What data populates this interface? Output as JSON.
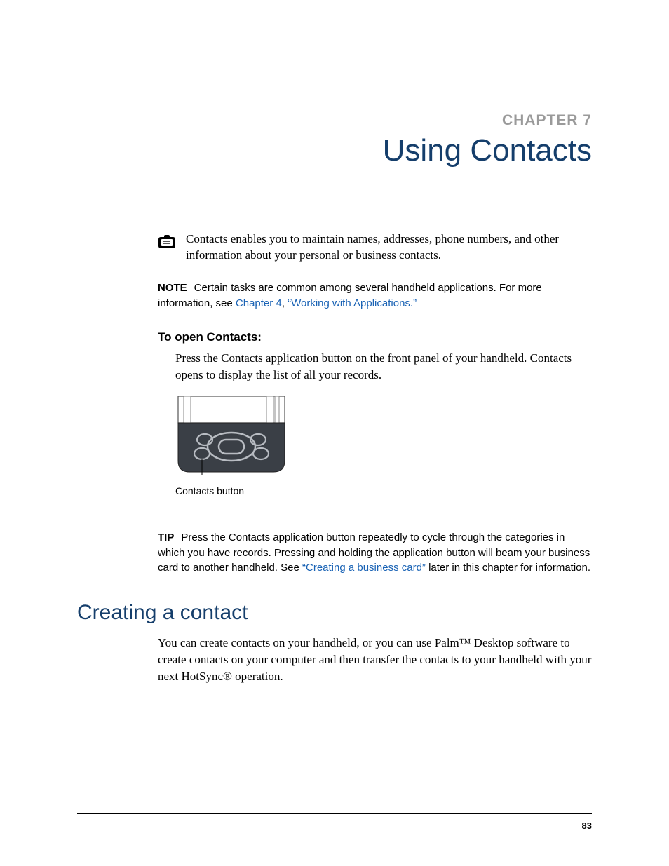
{
  "header": {
    "chapter_label": "CHAPTER 7",
    "title": "Using Contacts"
  },
  "lead": {
    "text": "Contacts enables you to maintain names, addresses, phone numbers, and other information about your personal or business contacts."
  },
  "note": {
    "label": "NOTE",
    "text_before": "Certain tasks are common among several handheld applications. For more information, see ",
    "link1": "Chapter 4",
    "sep": ", ",
    "link2": "“Working with Applications.”"
  },
  "subhead": "To open Contacts:",
  "step_text": "Press the Contacts application button on the front panel of your handheld. Contacts opens to display the list of all your records.",
  "figure_caption": "Contacts button",
  "tip": {
    "label": "TIP",
    "text_before": "Press the Contacts application button repeatedly to cycle through the categories in which you have records. Pressing and holding the application button will beam your business card to another handheld. See ",
    "link": "“Creating a business card”",
    "text_after": " later in this chapter for information."
  },
  "section_heading": "Creating a contact",
  "body": "You can create contacts on your handheld, or you can use Palm™ Desktop software to create contacts on your computer and then transfer the contacts to your handheld with your next HotSync® operation.",
  "page_number": "83"
}
